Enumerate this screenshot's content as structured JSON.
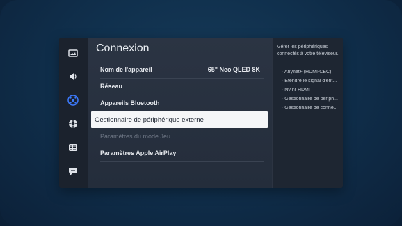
{
  "screen": {
    "title": "Connexion"
  },
  "rail": {
    "items": [
      {
        "icon": "picture-icon"
      },
      {
        "icon": "sound-icon"
      },
      {
        "icon": "connection-icon",
        "active": true
      },
      {
        "icon": "support-icon"
      },
      {
        "icon": "general-icon"
      },
      {
        "icon": "chat-icon"
      }
    ]
  },
  "menu": {
    "items": [
      {
        "label": "Nom de l'appareil",
        "value": "65\" Neo QLED 8K"
      },
      {
        "label": "Réseau"
      },
      {
        "label": "Appareils Bluetooth"
      },
      {
        "label": "Gestionnaire de périphérique externe",
        "selected": true
      },
      {
        "label": "Paramètres du mode Jeu",
        "disabled": true
      },
      {
        "label": "Paramètres Apple AirPlay"
      }
    ]
  },
  "help": {
    "description": "Gérer les périphériques connectés à votre téléviseur.",
    "items": [
      "· Anynet+ (HDMI-CEC)",
      "· Étendre le signal d'ent...",
      "· Nv nr HDMI",
      "· Gestionnaire de périph...",
      "· Gestionnaire de conne..."
    ]
  },
  "colors": {
    "accent": "#3d7bff",
    "selected_bg": "#f5f6f8",
    "panel": "#242d3b"
  }
}
